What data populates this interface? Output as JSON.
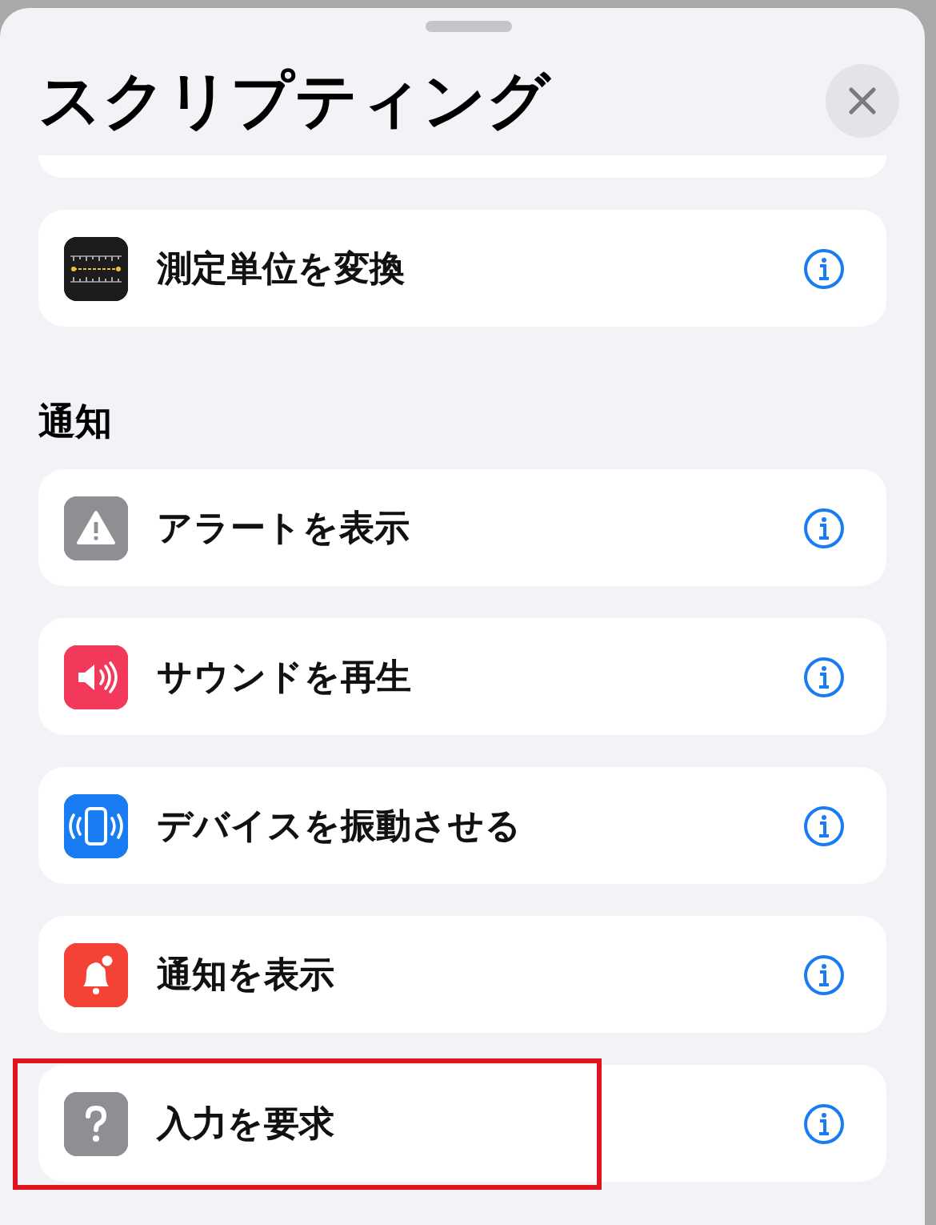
{
  "sheet": {
    "title": "スクリプティング"
  },
  "top_items": [
    {
      "label": "測定単位を変換",
      "kind": "ruler",
      "highlighted": false
    }
  ],
  "sections": [
    {
      "heading": "通知",
      "items": [
        {
          "label": "アラートを表示",
          "kind": "alert",
          "highlighted": false
        },
        {
          "label": "サウンドを再生",
          "kind": "sound",
          "highlighted": false
        },
        {
          "label": "デバイスを振動させる",
          "kind": "vibrate",
          "highlighted": false
        },
        {
          "label": "通知を表示",
          "kind": "notification",
          "highlighted": false
        },
        {
          "label": "入力を要求",
          "kind": "question",
          "highlighted": true
        }
      ]
    }
  ]
}
